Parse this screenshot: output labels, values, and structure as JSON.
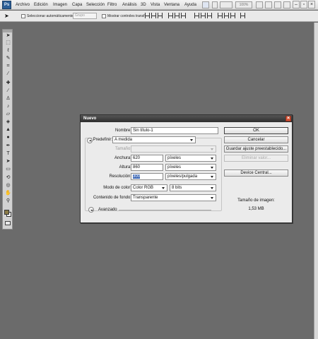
{
  "app": {
    "logo": "Ps"
  },
  "menubar": {
    "items": [
      "Archivo",
      "Edición",
      "Imagen",
      "Capa",
      "Selección",
      "Filtro",
      "Análisis",
      "3D",
      "Vista",
      "Ventana",
      "Ayuda"
    ],
    "zoom": "100%"
  },
  "options_bar": {
    "auto_select_label": "Seleccionar automáticamente:",
    "auto_select_value": "Grupo",
    "transform_label": "Mostrar controles transf."
  },
  "dialog": {
    "title": "Nuevo",
    "fields": {
      "name_label": "Nombre:",
      "name_value": "Sin título-1",
      "preset_label": "Predefinir:",
      "preset_value": "A medida",
      "size_label": "Tamaño:",
      "size_value": "",
      "width_label": "Anchura:",
      "width_value": "620",
      "width_unit": "píxeles",
      "height_label": "Altura:",
      "height_value": "860",
      "height_unit": "píxeles",
      "resolution_label": "Resolución:",
      "resolution_value": "300",
      "resolution_unit": "píxeles/pulgada",
      "color_mode_label": "Modo de color:",
      "color_mode_value": "Color RGB",
      "bit_depth_value": "8 bits",
      "background_label": "Contenido de fondo:",
      "background_value": "Transparente",
      "advanced_label": "Avanzado"
    },
    "buttons": {
      "ok": "OK",
      "cancel": "Cancelar",
      "save_preset": "Guardar ajuste preestablecido...",
      "delete_preset": "Eliminar valor...",
      "device_central": "Device Central..."
    },
    "image_info": {
      "title": "Tamaño de imagen:",
      "size": "1,53 MB"
    }
  },
  "colors": {
    "canvas_bg": "#6b6b6b",
    "foreground_swatch": "#8b7b48",
    "background_swatch": "#ffffff",
    "title_bar": "#3a3a3a",
    "close_button": "#d75335"
  }
}
